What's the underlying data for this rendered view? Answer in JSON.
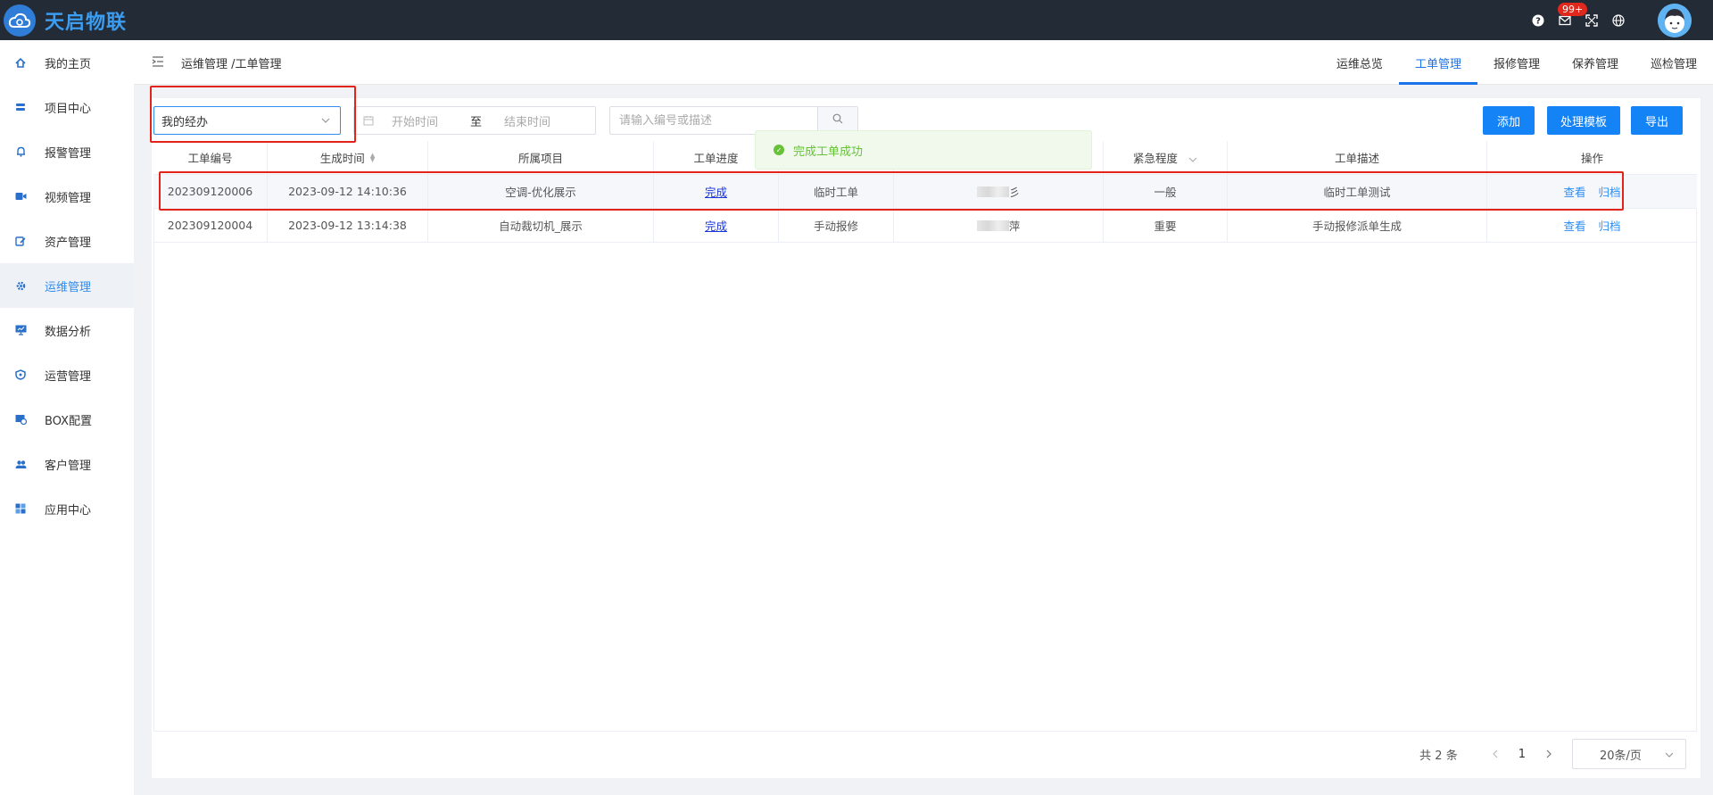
{
  "brand": {
    "name": "天启物联",
    "logo_color": "#3b9cf0"
  },
  "topbar": {
    "badge": "99+"
  },
  "sidebar": {
    "items": [
      {
        "label": "我的主页",
        "icon": "home-icon"
      },
      {
        "label": "项目中心",
        "icon": "stack-icon"
      },
      {
        "label": "报警管理",
        "icon": "bell-icon"
      },
      {
        "label": "视频管理",
        "icon": "video-icon"
      },
      {
        "label": "资产管理",
        "icon": "asset-icon"
      },
      {
        "label": "运维管理",
        "icon": "gear-icon"
      },
      {
        "label": "数据分析",
        "icon": "monitor-chart-icon"
      },
      {
        "label": "运营管理",
        "icon": "shield-icon"
      },
      {
        "label": "BOX配置",
        "icon": "box-config-icon"
      },
      {
        "label": "客户管理",
        "icon": "users-icon"
      },
      {
        "label": "应用中心",
        "icon": "apps-icon"
      }
    ],
    "active_index": 5
  },
  "header": {
    "breadcrumb": "运维管理 /工单管理",
    "tabs": [
      "运维总览",
      "工单管理",
      "报修管理",
      "保养管理",
      "巡检管理"
    ],
    "active_tab": 1
  },
  "filters": {
    "select_value": "我的经办",
    "start_placeholder": "开始时间",
    "range_sep": "至",
    "end_placeholder": "结束时间",
    "search_placeholder": "请输入编号或描述"
  },
  "actions": {
    "add": "添加",
    "template": "处理模板",
    "export": "导出"
  },
  "toast": {
    "message": "完成工单成功"
  },
  "table": {
    "columns": [
      "工单编号",
      "生成时间",
      "所属项目",
      "工单进度",
      "",
      "",
      "紧急程度",
      "工单描述",
      "操作"
    ],
    "rows": [
      {
        "id": "202309120006",
        "time": "2023-09-12 14:10:36",
        "project": "空调-优化展示",
        "progress": "完成",
        "type": "临时工单",
        "person_suffix": "彡",
        "urgency": "一般",
        "desc": "临时工单测试",
        "view": "查看",
        "archive": "归档"
      },
      {
        "id": "202309120004",
        "time": "2023-09-12 13:14:38",
        "project": "自动裁切机_展示",
        "progress": "完成",
        "type": "手动报修",
        "person_suffix": "萍",
        "urgency": "重要",
        "desc": "手动报修派单生成",
        "view": "查看",
        "archive": "归档"
      }
    ]
  },
  "pagination": {
    "total": "共 2 条",
    "page": "1",
    "page_size": "20条/页"
  }
}
